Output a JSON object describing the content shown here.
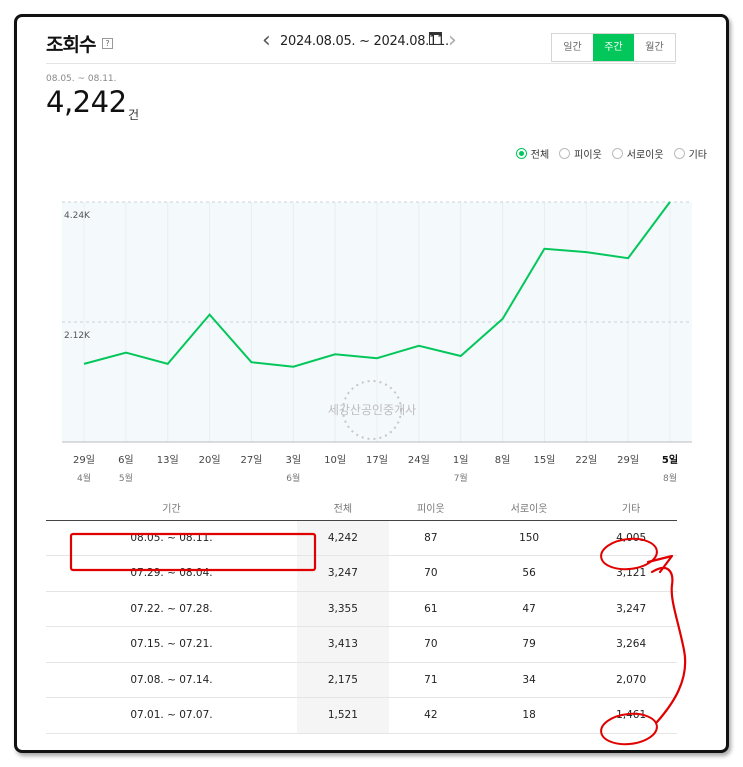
{
  "header": {
    "title": "조회수",
    "help": "?",
    "date_range": "2024.08.05. ~ 2024.08.11.",
    "period_tabs": [
      {
        "label": "일간",
        "active": false
      },
      {
        "label": "주간",
        "active": true
      },
      {
        "label": "월간",
        "active": false
      }
    ]
  },
  "summary": {
    "date_range": "08.05. ~ 08.11.",
    "total": "4,242",
    "unit": "건"
  },
  "legend": [
    {
      "label": "전체",
      "selected": true
    },
    {
      "label": "피이웃",
      "selected": false
    },
    {
      "label": "서로이웃",
      "selected": false
    },
    {
      "label": "기타",
      "selected": false
    }
  ],
  "watermark": "세강산공인중개사",
  "colors": {
    "accent": "#03c75a",
    "annotation": "#e00000"
  },
  "chart_data": {
    "type": "line",
    "y_tick_labels": [
      "4.24K",
      "2.12K"
    ],
    "y_ticks": [
      4240,
      2120
    ],
    "ylim": [
      0,
      4240
    ],
    "x_labels": [
      {
        "day": "29일",
        "month": "4월",
        "bold": false
      },
      {
        "day": "6일",
        "month": "5월",
        "bold": false
      },
      {
        "day": "13일",
        "month": "",
        "bold": false
      },
      {
        "day": "20일",
        "month": "",
        "bold": false
      },
      {
        "day": "27일",
        "month": "",
        "bold": false
      },
      {
        "day": "3일",
        "month": "6월",
        "bold": false
      },
      {
        "day": "10일",
        "month": "",
        "bold": false
      },
      {
        "day": "17일",
        "month": "",
        "bold": false
      },
      {
        "day": "24일",
        "month": "",
        "bold": false
      },
      {
        "day": "1일",
        "month": "7월",
        "bold": false
      },
      {
        "day": "8일",
        "month": "",
        "bold": false
      },
      {
        "day": "15일",
        "month": "",
        "bold": false
      },
      {
        "day": "22일",
        "month": "",
        "bold": false
      },
      {
        "day": "29일",
        "month": "",
        "bold": false
      },
      {
        "day": "5일",
        "month": "8월",
        "bold": true
      }
    ],
    "series": [
      {
        "values": [
          1380,
          1580,
          1380,
          2250,
          1410,
          1330,
          1550,
          1480,
          1700,
          1520,
          2175,
          3413,
          3355,
          3247,
          4242
        ]
      }
    ],
    "grid": true
  },
  "table": {
    "headers": [
      "기간",
      "전체",
      "피이웃",
      "서로이웃",
      "기타"
    ],
    "rows": [
      [
        "08.05. ~ 08.11.",
        "4,242",
        "87",
        "150",
        "4,005"
      ],
      [
        "07.29. ~ 08.04.",
        "3,247",
        "70",
        "56",
        "3,121"
      ],
      [
        "07.22. ~ 07.28.",
        "3,355",
        "61",
        "47",
        "3,247"
      ],
      [
        "07.15. ~ 07.21.",
        "3,413",
        "70",
        "79",
        "3,264"
      ],
      [
        "07.08. ~ 07.14.",
        "2,175",
        "71",
        "34",
        "2,070"
      ],
      [
        "07.01. ~ 07.07.",
        "1,521",
        "42",
        "18",
        "1,461"
      ]
    ]
  }
}
